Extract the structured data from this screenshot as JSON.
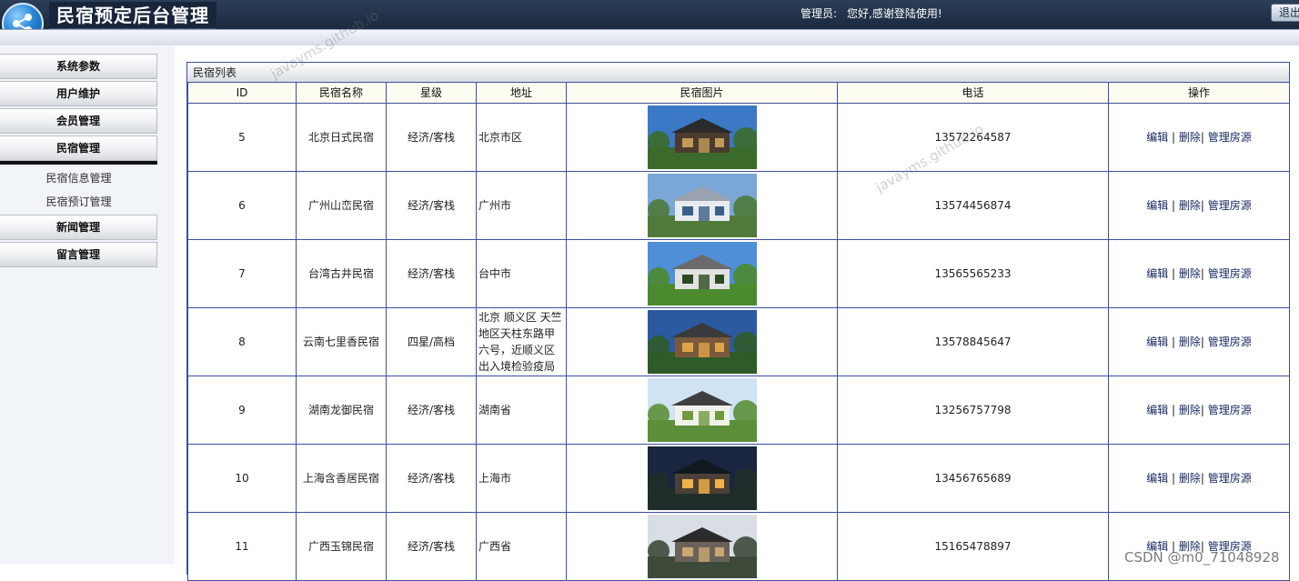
{
  "header": {
    "title": "民宿预定后台管理",
    "admin_label": "管理员:",
    "greeting": "您好,感谢登陆使用!",
    "logout": "退出"
  },
  "sidebar": {
    "menu": [
      {
        "label": "系统参数"
      },
      {
        "label": "用户维护"
      },
      {
        "label": "会员管理"
      },
      {
        "label": "民宿管理"
      }
    ],
    "submenu": [
      {
        "label": "民宿信息管理"
      },
      {
        "label": "民宿预订管理"
      }
    ],
    "menu2": [
      {
        "label": "新闻管理"
      },
      {
        "label": "留言管理"
      }
    ]
  },
  "panel": {
    "title": "民宿列表",
    "columns": [
      "ID",
      "民宿名称",
      "星级",
      "地址",
      "民宿图片",
      "电话",
      "操作"
    ],
    "actions": {
      "edit": "编辑",
      "delete": "删除",
      "rooms": "管理房源",
      "sep": "|"
    },
    "rows": [
      {
        "id": "5",
        "name": "北京日式民宿",
        "star": "经济/客栈",
        "address": "北京市区",
        "phone": "13572264587",
        "pic": "house-forest"
      },
      {
        "id": "6",
        "name": "广州山峦民宿",
        "star": "经济/客栈",
        "address": "广州市",
        "phone": "13574456874",
        "pic": "house-modern-white"
      },
      {
        "id": "7",
        "name": "台湾古井民宿",
        "star": "经济/客栈",
        "address": "台中市",
        "phone": "13565565233",
        "pic": "house-lawn"
      },
      {
        "id": "8",
        "name": "云南七里香民宿",
        "star": "四星/高档",
        "address": "北京 顺义区 天竺地区天柱东路甲六号，近顺义区出入境检验疫局",
        "phone": "13578845647",
        "pic": "house-courtyard"
      },
      {
        "id": "9",
        "name": "湖南龙御民宿",
        "star": "经济/客栈",
        "address": "湖南省",
        "phone": "13256757798",
        "pic": "house-garden"
      },
      {
        "id": "10",
        "name": "上海含香居民宿",
        "star": "经济/客栈",
        "address": "上海市",
        "phone": "13456765689",
        "pic": "house-night"
      },
      {
        "id": "11",
        "name": "广西玉锦民宿",
        "star": "经济/客栈",
        "address": "广西省",
        "phone": "15165478897",
        "pic": "house-pine"
      }
    ]
  },
  "watermarks": [
    "javayms.github.io",
    "javayms.github.io"
  ],
  "csdn_mark": "CSDN @m0_71048928",
  "colors": {
    "header_dark": "#1b2a40",
    "table_border": "#3d4f9e",
    "header_cell_bg": "#fdfcf0",
    "link": "#1a2a66"
  }
}
